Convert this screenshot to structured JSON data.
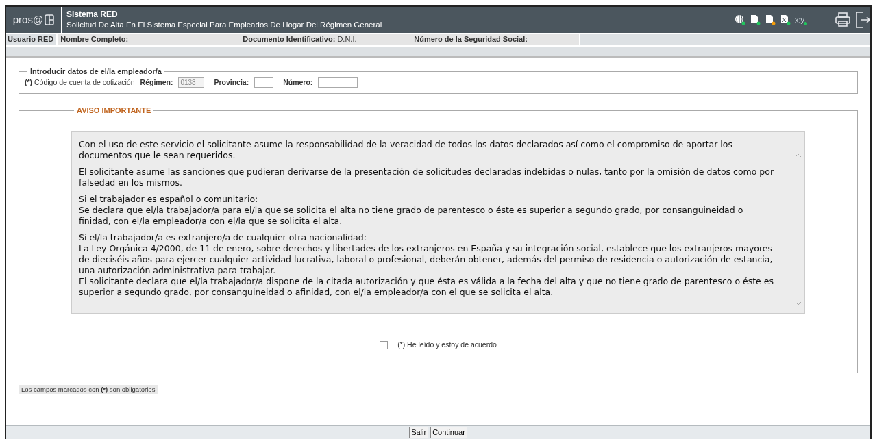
{
  "header": {
    "logo": "pros@",
    "system": "Sistema RED",
    "title": "Solicitud De Alta En El Sistema Especial Para Empleados De Hogar Del Régimen General",
    "tools": [
      {
        "kind": "globe",
        "color": "#22c55e"
      },
      {
        "kind": "doc",
        "color": "#22c55e"
      },
      {
        "kind": "doc",
        "color": "#f59e0b"
      },
      {
        "kind": "xdoc",
        "color": "#22c55e"
      },
      {
        "kind": "text",
        "label": "x:y",
        "color": "#22c55e"
      }
    ]
  },
  "info_bar": {
    "user": "Usuario RED",
    "name_label": "Nombre Completo:",
    "doc_label": "Documento Identificativo:",
    "doc_value": "D.N.I.",
    "ss_label": "Número de la Seguridad Social:"
  },
  "employer": {
    "legend": "Introducir datos de el/la empleador/a",
    "required_mark": "(*)",
    "account_label": "Código de cuenta de cotización",
    "regimen_label": "Régimen:",
    "regimen_value": "0138",
    "provincia_label": "Provincia:",
    "numero_label": "Número:"
  },
  "notice": {
    "legend": "AVISO IMPORTANTE",
    "paragraphs": [
      {
        "lines": [
          "Con el uso de este servicio el solicitante asume la responsabilidad de la veracidad de todos los datos declarados así como el compromiso de aportar los documentos que le sean requeridos."
        ]
      },
      {
        "lines": [
          "El solicitante asume las sanciones que pudieran derivarse de la presentación de solicitudes declaradas indebidas o nulas, tanto por la omisión de datos como por falsedad en los mismos."
        ]
      },
      {
        "lines": [
          "Si el trabajador es español o comunitario:",
          "Se declara que el/la trabajador/a para el/la que se solicita el alta no tiene grado de parentesco o éste es superior a segundo grado, por consanguineidad o finidad, con el/la empleador/a con el/la que se solicita el alta."
        ]
      },
      {
        "lines": [
          "Si el/la trabajador/a es extranjero/a de cualquier otra nacionalidad:",
          "La Ley Orgánica 4/2000, de 11 de enero, sobre derechos y libertades de los extranjeros en España y su integración social, establece que los extranjeros mayores de dieciséis años para ejercer cualquier actividad lucrativa, laboral o profesional, deberán obtener, además del permiso de residencia o autorización de estancia, una autorización administrativa para trabajar.",
          "El solicitante declara que el/la trabajador/a dispone de la citada autorización y que ésta es válida a la fecha del alta y que no tiene grado de parentesco o éste es superior a segundo grado, por consanguineidad o afinidad, con el/la empleador/a con el que se solicita el alta."
        ]
      }
    ],
    "agree": {
      "label": "(*) He leído y estoy de acuerdo",
      "checked": false
    }
  },
  "required_note": {
    "prefix": "Los campos marcados con",
    "mark": "(*)",
    "suffix": "son obligatorios"
  },
  "buttons": [
    "Salir",
    "Continuar"
  ]
}
